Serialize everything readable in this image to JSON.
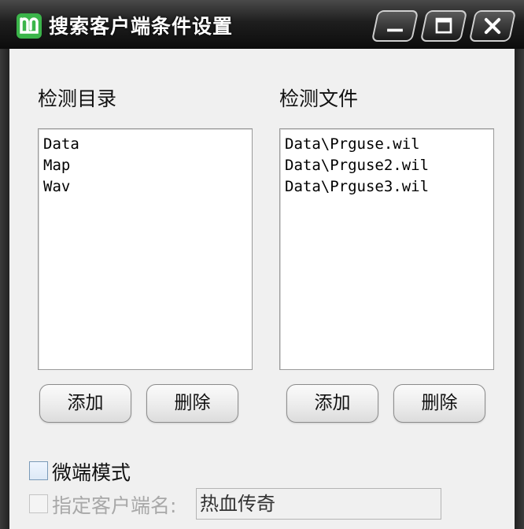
{
  "window": {
    "title": "搜索客户端条件设置"
  },
  "left_panel": {
    "label": "检测目录",
    "items": [
      "Data",
      "Map",
      "Wav"
    ],
    "add_button": "添加",
    "delete_button": "删除"
  },
  "right_panel": {
    "label": "检测文件",
    "items": [
      "Data\\Prguse.wil",
      "Data\\Prguse2.wil",
      "Data\\Prguse3.wil"
    ],
    "add_button": "添加",
    "delete_button": "删除"
  },
  "options": {
    "micro_mode": {
      "label": "微端模式",
      "checked": false
    },
    "client_name": {
      "label": "指定客户端名:",
      "value": "热血传奇",
      "checked": false,
      "enabled": false
    }
  },
  "colors": {
    "titlebar": "#0c0c0c",
    "client_bg": "#f0f0f0",
    "app_icon": "#3bb54a",
    "disabled_text": "#a8a8a8"
  }
}
